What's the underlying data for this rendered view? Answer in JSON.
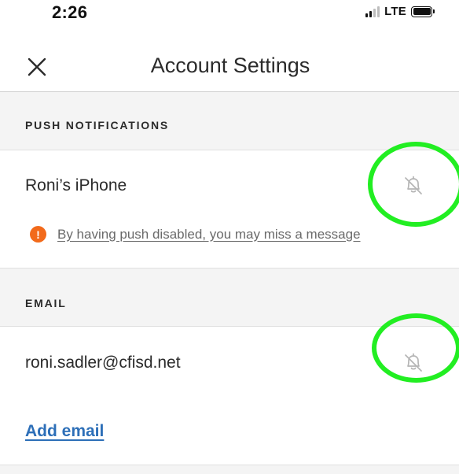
{
  "status_bar": {
    "time": "2:26",
    "network": "LTE",
    "icons": [
      "signal-icon",
      "battery-icon"
    ]
  },
  "header": {
    "title": "Account Settings",
    "close_icon": "close-icon"
  },
  "push_section": {
    "header": "PUSH NOTIFICATIONS",
    "device_name": "Roni’s iPhone",
    "toggle_icon": "bell-off-icon",
    "warning_icon": "exclamation",
    "warning_text": "By having push disabled, you may miss a message",
    "warning_mark": "!"
  },
  "email_section": {
    "header": "EMAIL",
    "address": "roni.sadler@cfisd.net",
    "toggle_icon": "bell-off-icon",
    "add_label": "Add email"
  },
  "colors": {
    "accent_link": "#2d6fb8",
    "warning": "#f26a1b",
    "highlight": "#22ee22",
    "section_bg": "#f4f4f4"
  }
}
